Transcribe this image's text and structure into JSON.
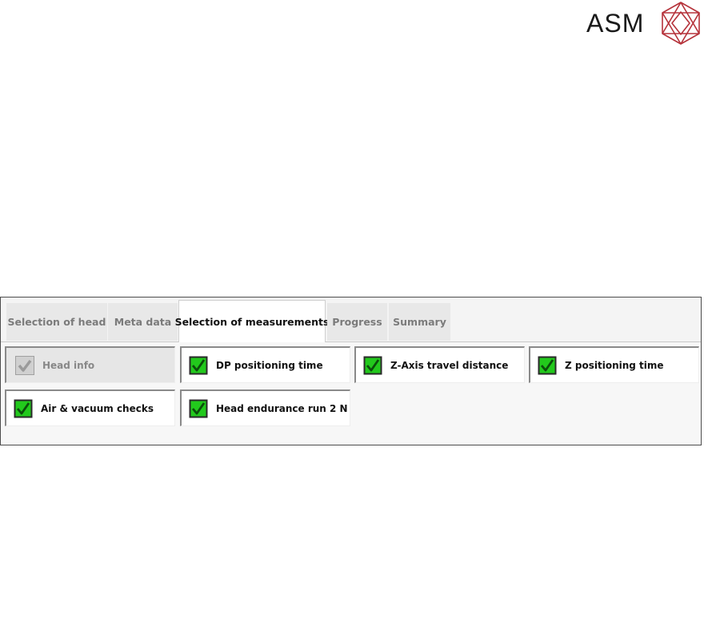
{
  "logo": {
    "text": "ASM"
  },
  "tabs": [
    {
      "label": "Selection of head",
      "active": false
    },
    {
      "label": "Meta data",
      "active": false
    },
    {
      "label": "Selection of measurements",
      "active": true
    },
    {
      "label": "Progress",
      "active": false
    },
    {
      "label": "Summary",
      "active": false
    }
  ],
  "measurements": [
    {
      "label": "Head info",
      "checked": true,
      "disabled": true
    },
    {
      "label": "DP positioning time",
      "checked": true,
      "disabled": false
    },
    {
      "label": "Z-Axis travel distance",
      "checked": true,
      "disabled": false
    },
    {
      "label": "Z positioning time",
      "checked": true,
      "disabled": false
    },
    {
      "label": "Air & vacuum checks",
      "checked": true,
      "disabled": false
    },
    {
      "label": "Head endurance run 2 N",
      "checked": true,
      "disabled": false
    }
  ],
  "colors": {
    "check_green": "#22c91c",
    "check_mark": "#0b4f0b",
    "logo_red": "#b5323a"
  }
}
